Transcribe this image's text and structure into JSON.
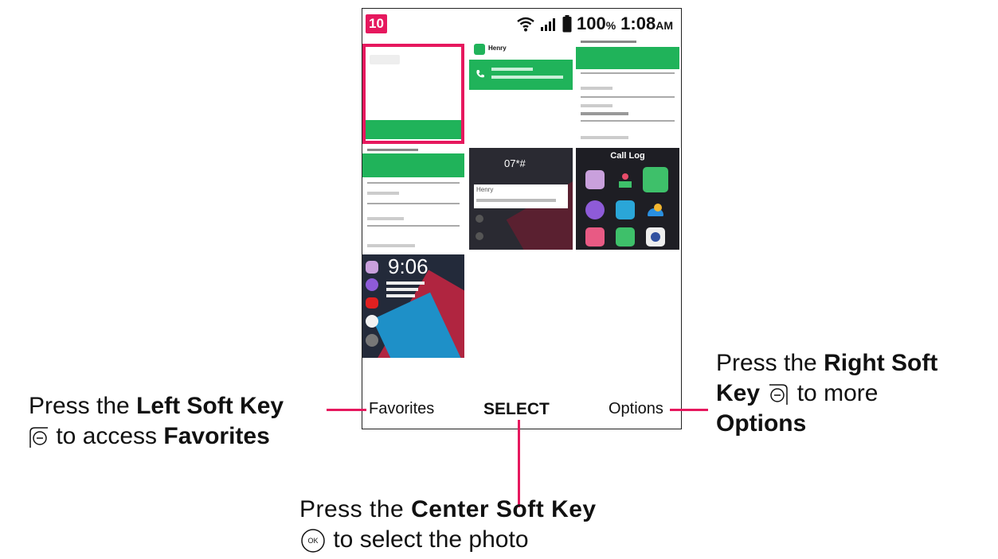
{
  "status_bar": {
    "notification_count": "10",
    "battery": "100",
    "battery_unit": "%",
    "time": "1:08",
    "ampm": "AM"
  },
  "thumbnails": {
    "contact_name": "Henry",
    "call_log_title": "Call Log",
    "dialer_entry": "07*#",
    "lock_time": "9:06"
  },
  "softkeys": {
    "left": "Favorites",
    "center": "SELECT",
    "right": "Options"
  },
  "annotations": {
    "left_prefix": "Press the ",
    "left_key": "Left Soft Key",
    "left_suffix": " to access ",
    "left_target": "Favorites",
    "right_prefix": "Press the ",
    "right_key_1": "Right Soft",
    "right_key_2": "Key",
    "right_suffix": " to more",
    "right_target": "Options",
    "center_prefix": "Press the ",
    "center_key": "Center Soft Key",
    "center_suffix": " to select the photo",
    "ok_glyph": "OK"
  },
  "colors": {
    "accent": "#e6185e",
    "green": "#20b35a"
  }
}
